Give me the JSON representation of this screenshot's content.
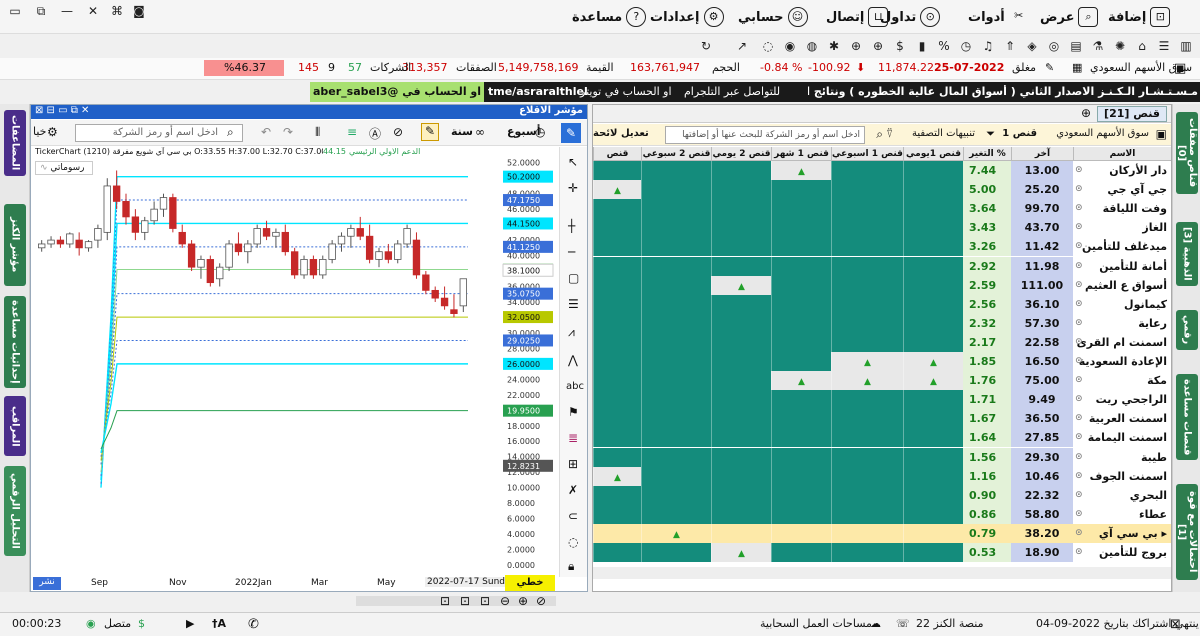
{
  "menu": {
    "add": "إضافة",
    "view": "عرض",
    "tools": "أدوات",
    "trade": "تداول",
    "connect": "إتصال",
    "account": "حسابي",
    "settings": "إعدادات",
    "help": "مساعدة"
  },
  "stats": {
    "market": "سوق الأسهم السعودي",
    "status": "مغلق",
    "date": "25-07-2022",
    "index": "11,874.22",
    "change": "-100.92",
    "change_pct": "-0.84 %",
    "volume_label": "الحجم",
    "volume": "163,761,947",
    "value_label": "القيمة",
    "value": "5,149,758,169",
    "trades_label": "الصفقات",
    "trades": "313,357",
    "companies_label": "الشركات",
    "up": "57",
    "flat": "9",
    "down": "145",
    "pct": "%46.37"
  },
  "ticker": {
    "handle1": "aber_sabel3@ او الحساب في تويتر",
    "handle2": "tme/asraralthlel",
    "text": "للتواصل عبر التلجرام",
    "news": "مـسـتـشـار الـكـنـز الاصدار الثاني ( أسواق المال عالية الخطوره ) ونتائج المنصة لا تعتبر توصيات شراء او بيع"
  },
  "left_tabs": [
    "المضاعفات",
    "مؤشر الكنز",
    "إحداثيات مساعدة",
    "المراقب",
    "التحليل الرقمي"
  ],
  "right_tabs": [
    "قناص صفقات [0]",
    "الذهبية [3]",
    "رقمي",
    "قنصات مساعدة",
    "احتمالات مع قوة [1]"
  ],
  "chart": {
    "title": "مؤشر الاقلاع",
    "period": "أسبوع",
    "year": "سنة",
    "search_placeholder": "ادخل اسم أو رمز الشركة",
    "ohlc": "TickerChart بي سي آي شويع مفرقة (1210) O:33.55 H:37.00 L:32.70 C:37.00",
    "legend": "رسوماتي",
    "note1": "44.15",
    "note2": "الدعم الاولي الرئيسي",
    "x_labels": [
      "Sep",
      "Nov",
      "2022Jan",
      "Mar",
      "May"
    ],
    "date_tag": "2022-07-17 Sunday",
    "linear": "خطي",
    "share": "نشر"
  },
  "chart_data": {
    "type": "candlestick",
    "title": "مؤشر الاقلاع",
    "ylim": [
      0,
      53
    ],
    "yticks": [
      "52.0000",
      "50.0000",
      "48.0000",
      "46.0000",
      "44.0000",
      "42.0000",
      "40.0000",
      "38.0000",
      "36.0000",
      "34.0000",
      "32.0000",
      "30.0000",
      "28.0000",
      "26.0000",
      "24.0000",
      "22.0000",
      "20.0000",
      "18.0000",
      "16.0000",
      "14.0000",
      "12.0000",
      "10.0000",
      "8.0000",
      "6.0000",
      "4.0000",
      "2.0000",
      "0.0000"
    ],
    "levels": [
      {
        "value": 50.2,
        "label": "50.2000",
        "color": "#00e5ff"
      },
      {
        "value": 47.175,
        "label": "47.1750",
        "color": "#3a6fd8"
      },
      {
        "value": 44.15,
        "label": "44.1500",
        "color": "#00e5ff"
      },
      {
        "value": 41.125,
        "label": "41.1250",
        "color": "#3a6fd8"
      },
      {
        "value": 38.2,
        "label": "38.2000",
        "color": "#8fd88f"
      },
      {
        "value": 38.1,
        "label": "38.1000",
        "color": "#ffffff"
      },
      {
        "value": 35.075,
        "label": "35.0750",
        "color": "#3a6fd8"
      },
      {
        "value": 32.05,
        "label": "32.0500",
        "color": "#b8c800"
      },
      {
        "value": 29.025,
        "label": "29.0250",
        "color": "#3a6fd8"
      },
      {
        "value": 26.0,
        "label": "26.0000",
        "color": "#00e5ff"
      },
      {
        "value": 19.95,
        "label": "19.9500",
        "color": "#28a050"
      },
      {
        "value": 12.8231,
        "label": "12.8231",
        "color": "#555555"
      }
    ],
    "candles": [
      [
        41,
        42,
        40.5,
        41.5
      ],
      [
        41.5,
        42.5,
        41,
        42
      ],
      [
        42,
        42.5,
        41,
        41.5
      ],
      [
        41.5,
        43,
        41,
        42.8
      ],
      [
        42,
        43,
        40,
        41
      ],
      [
        41,
        42,
        40.5,
        41.8
      ],
      [
        42,
        44,
        41,
        43.5
      ],
      [
        43,
        50,
        42,
        49
      ],
      [
        49,
        51,
        46,
        47
      ],
      [
        47,
        48,
        44,
        45
      ],
      [
        45,
        46,
        42,
        43
      ],
      [
        43,
        45,
        42,
        44.5
      ],
      [
        44.5,
        47,
        44,
        46
      ],
      [
        46,
        48,
        45,
        47.5
      ],
      [
        47.5,
        48,
        43,
        43.5
      ],
      [
        43,
        44,
        41,
        41.5
      ],
      [
        41.5,
        42,
        38,
        38.5
      ],
      [
        38.5,
        40,
        37,
        39.5
      ],
      [
        39.5,
        40,
        36,
        36.5
      ],
      [
        37,
        39,
        36,
        38.5
      ],
      [
        38.5,
        42,
        38,
        41.5
      ],
      [
        41.5,
        43,
        40,
        40.5
      ],
      [
        40.5,
        42,
        39,
        41.5
      ],
      [
        41.5,
        44,
        41,
        43.5
      ],
      [
        43.5,
        44.5,
        42,
        42.5
      ],
      [
        42.5,
        43.5,
        41,
        43
      ],
      [
        43,
        44,
        40,
        40.5
      ],
      [
        40.5,
        41,
        37,
        37.5
      ],
      [
        37.5,
        40,
        37,
        39.5
      ],
      [
        39.5,
        40,
        37,
        37.5
      ],
      [
        37.5,
        40,
        37,
        39.5
      ],
      [
        39.5,
        42,
        39,
        41.5
      ],
      [
        41.5,
        43,
        40.5,
        42.5
      ],
      [
        42.5,
        44,
        41,
        43.5
      ],
      [
        43.5,
        45,
        42,
        42.5
      ],
      [
        42.5,
        44,
        39,
        39.5
      ],
      [
        39.5,
        41,
        38.5,
        40.5
      ],
      [
        40.5,
        41.5,
        39,
        39.5
      ],
      [
        39.5,
        42,
        39,
        41.5
      ],
      [
        41.5,
        44,
        41,
        43.5
      ],
      [
        42,
        43,
        37,
        37.5
      ],
      [
        37.5,
        38,
        35,
        35.5
      ],
      [
        35.5,
        36,
        34,
        34.5
      ],
      [
        34.5,
        36,
        33,
        33.5
      ],
      [
        33,
        35,
        32,
        32.5
      ],
      [
        33.5,
        37,
        32.7,
        37
      ]
    ]
  },
  "table": {
    "title": "قنص [21]",
    "market": "سوق الأسهم السعودي",
    "filter": "قنص 1",
    "alerts": "تنبيهات التصفية",
    "search_placeholder": "ادخل اسم أو رمز الشركة للبحث عنها أو إضافتها",
    "edit": "تعديل لائحة",
    "headers": [
      "الاسم",
      "آخر",
      "التغير %",
      "قنص 1يومي",
      "قنص 1 اسبوعي",
      "قنص 1 شهر",
      "قنص 2 يومي",
      "قنص 2 سبوعي",
      "قنص"
    ],
    "rows": [
      {
        "name": "دار الأركان",
        "last": "13.00",
        "chg": "7.44",
        "up": [
          2
        ]
      },
      {
        "name": "جي آي جي",
        "last": "25.20",
        "chg": "5.00",
        "up": [
          5
        ]
      },
      {
        "name": "وفت اللياقة",
        "last": "99.70",
        "chg": "3.64",
        "up": []
      },
      {
        "name": "الغاز",
        "last": "43.70",
        "chg": "3.43",
        "up": []
      },
      {
        "name": "ميدغلف للتأمين",
        "last": "11.42",
        "chg": "3.26",
        "up": []
      },
      {
        "name": "أمانة للتأمين",
        "last": "11.98",
        "chg": "2.92",
        "up": []
      },
      {
        "name": "أسواق ع العثيم",
        "last": "111.00",
        "chg": "2.59",
        "up": [
          3
        ]
      },
      {
        "name": "كيمانول",
        "last": "36.10",
        "chg": "2.56",
        "up": []
      },
      {
        "name": "رعاية",
        "last": "57.30",
        "chg": "2.32",
        "up": []
      },
      {
        "name": "اسمنت ام القرى",
        "last": "22.58",
        "chg": "2.17",
        "up": []
      },
      {
        "name": "الإعادة السعودية",
        "last": "16.50",
        "chg": "1.85",
        "up": [
          0,
          1
        ]
      },
      {
        "name": "مكة",
        "last": "75.00",
        "chg": "1.76",
        "up": [
          0,
          1,
          2
        ]
      },
      {
        "name": "الراجحي ريت",
        "last": "9.49",
        "chg": "1.71",
        "up": []
      },
      {
        "name": "اسمنت العربية",
        "last": "36.50",
        "chg": "1.67",
        "up": []
      },
      {
        "name": "اسمنت اليمامة",
        "last": "27.85",
        "chg": "1.64",
        "up": []
      },
      {
        "name": "طيبة",
        "last": "29.30",
        "chg": "1.56",
        "up": []
      },
      {
        "name": "اسمنت الجوف",
        "last": "10.46",
        "chg": "1.16",
        "up": [
          5
        ]
      },
      {
        "name": "البحري",
        "last": "22.32",
        "chg": "0.90",
        "up": []
      },
      {
        "name": "عطاء",
        "last": "58.80",
        "chg": "0.86",
        "up": []
      },
      {
        "name": "بي سي آي",
        "last": "38.20",
        "chg": "0.79",
        "up": [
          4
        ]
      },
      {
        "name": "بروج للتأمين",
        "last": "18.90",
        "chg": "0.53",
        "up": [
          3
        ]
      }
    ]
  },
  "statusbar": {
    "subscription": "ينتهي اشتراكك بتاريخ 2022-09-04",
    "platform": "منصة الكنز 22",
    "workspace": "مساحات العمل السحابية",
    "connected": "متصل",
    "time": "00:00:23"
  }
}
